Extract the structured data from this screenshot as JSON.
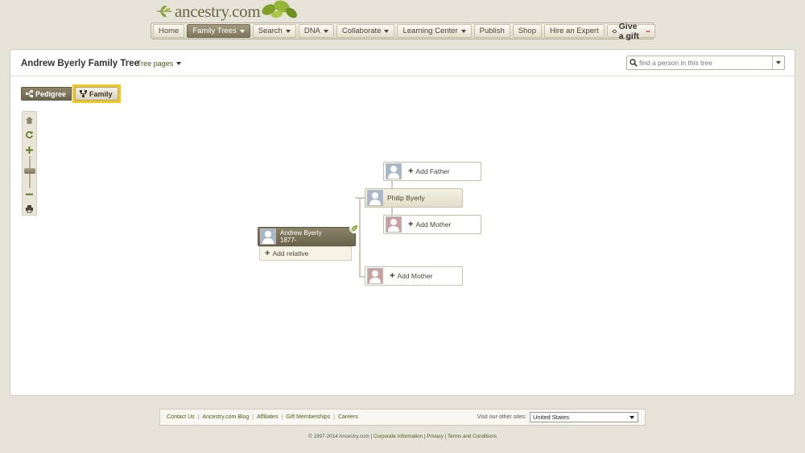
{
  "brand": {
    "name": "ancestry",
    "suffix": "com"
  },
  "nav": {
    "items": [
      {
        "label": "Home",
        "dropdown": false,
        "active": false
      },
      {
        "label": "Family Trees",
        "dropdown": true,
        "active": true
      },
      {
        "label": "Search",
        "dropdown": true,
        "active": false
      },
      {
        "label": "DNA",
        "dropdown": true,
        "active": false
      },
      {
        "label": "Collaborate",
        "dropdown": true,
        "active": false
      },
      {
        "label": "Learning Center",
        "dropdown": true,
        "active": false
      },
      {
        "label": "Publish",
        "dropdown": false,
        "active": false
      },
      {
        "label": "Shop",
        "dropdown": false,
        "active": false
      },
      {
        "label": "Hire an Expert",
        "dropdown": false,
        "active": false
      }
    ],
    "gift_label": "Give a gift"
  },
  "tree": {
    "title": "Andrew Byerly Family Tree",
    "pages_label": "Tree pages",
    "search_placeholder": "find a person in this tree"
  },
  "view_toggle": {
    "pedigree": "Pedigree",
    "family": "Family",
    "selected": "Family"
  },
  "people": {
    "focus": {
      "name": "Andrew Byerly",
      "dates": "1877-"
    },
    "add_relative": "Add relative",
    "father": {
      "name": "Philip Byerly"
    },
    "grandfather_add": "Add Father",
    "grandmother_add": "Add Mother",
    "mother_add": "Add Mother"
  },
  "footer": {
    "links": [
      "Contact Us",
      "Ancestry.com Blog",
      "Affiliates",
      "Gift Memberships",
      "Careers"
    ],
    "visit_label": "Visit our other sites:",
    "country": "United States",
    "copyright": "© 1997-2014 Ancestry.com",
    "legal_links": [
      "Corporate Information",
      "Privacy",
      "Terms and Conditions"
    ]
  },
  "colors": {
    "brand_olive": "#6d6542",
    "link_green": "#4a5f1a",
    "highlight": "#f5c718"
  }
}
